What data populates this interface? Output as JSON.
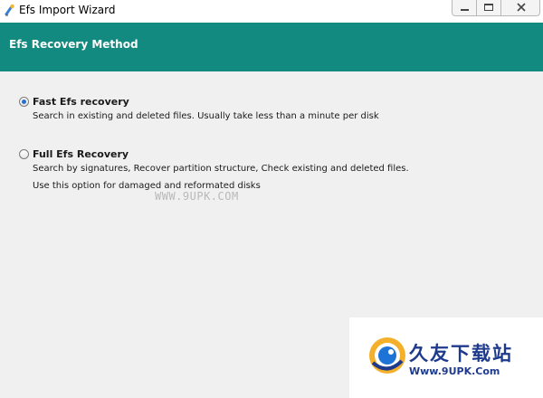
{
  "window": {
    "title": "Efs Import Wizard",
    "icon": "wizard-app-icon",
    "controls": [
      "minimize-icon",
      "restore-icon",
      "close-icon"
    ]
  },
  "header": {
    "title": "Efs Recovery Method",
    "color": "#128a7f"
  },
  "options": [
    {
      "label": "Fast Efs recovery",
      "selected": true,
      "description": [
        "Search in existing and deleted files. Usually take less than a minute per disk"
      ]
    },
    {
      "label": "Full Efs Recovery",
      "selected": false,
      "description": [
        "Search by signatures, Recover partition structure, Check existing and deleted files.",
        "Use this option for damaged and reformated disks"
      ]
    }
  ],
  "watermark": {
    "text": "WWW.9UPK.COM"
  },
  "logo": {
    "title": "久友下载站",
    "url": "Www.9UPK.Com"
  },
  "colors": {
    "accent": "#128a7f",
    "radio_dot": "#2a6fc9",
    "logo_blue": "#1e3a8c",
    "body_bg": "#f0f0f0"
  }
}
